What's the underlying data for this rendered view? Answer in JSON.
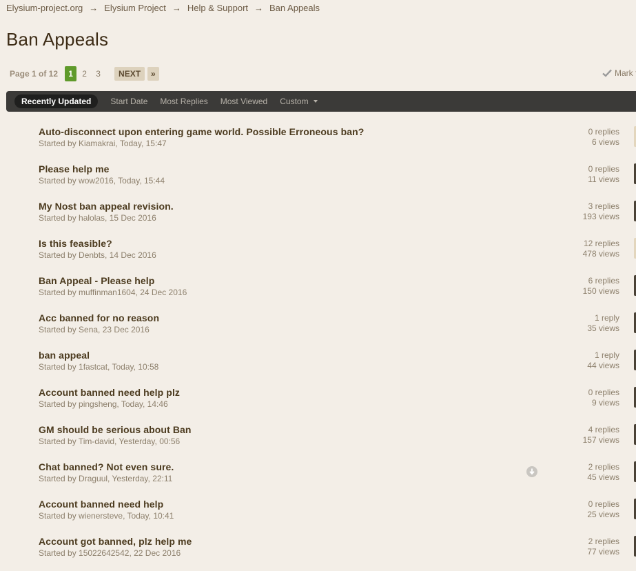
{
  "breadcrumb": {
    "items": [
      "Elysium-project.org",
      "Elysium Project",
      "Help & Support",
      "Ban Appeals"
    ],
    "separator": "→"
  },
  "page": {
    "title": "Ban Appeals"
  },
  "pagination": {
    "label": "Page 1 of 12",
    "pages": [
      "1",
      "2",
      "3"
    ],
    "current": "1",
    "next_label": "NEXT",
    "last_label": "»"
  },
  "mark_read": {
    "label": "Mark f"
  },
  "filters": {
    "recently_updated": "Recently Updated",
    "start_date": "Start Date",
    "most_replies": "Most Replies",
    "most_viewed": "Most Viewed",
    "custom": "Custom"
  },
  "topics": [
    {
      "title": "Auto-disconnect upon entering game world. Possible Erroneous ban?",
      "meta": "Started by Kiamakrai, Today, 15:47",
      "replies": "0 replies",
      "views": "6 views"
    },
    {
      "title": "Please help me",
      "meta": "Started by wow2016, Today, 15:44",
      "replies": "0 replies",
      "views": "11 views"
    },
    {
      "title": "My Nost ban appeal revision.",
      "meta": "Started by halolas, 15 Dec 2016",
      "replies": "3 replies",
      "views": "193 views"
    },
    {
      "title": "Is this feasible?",
      "meta": "Started by Denbts, 14 Dec 2016",
      "replies": "12 replies",
      "views": "478 views"
    },
    {
      "title": "Ban Appeal - Please help",
      "meta": "Started by muffinman1604, 24 Dec 2016",
      "replies": "6 replies",
      "views": "150 views"
    },
    {
      "title": "Acc banned for no reason",
      "meta": "Started by Sena, 23 Dec 2016",
      "replies": "1 reply",
      "views": "35 views"
    },
    {
      "title": "ban appeal",
      "meta": "Started by 1fastcat, Today, 10:58",
      "replies": "1 reply",
      "views": "44 views"
    },
    {
      "title": "Account banned need help plz",
      "meta": "Started by pingsheng, Today, 14:46",
      "replies": "0 replies",
      "views": "9 views"
    },
    {
      "title": "GM should be serious about Ban",
      "meta": "Started by Tim-david, Yesterday, 00:56",
      "replies": "4 replies",
      "views": "157 views"
    },
    {
      "title": "Chat banned? Not even sure.",
      "meta": "Started by Draguul, Yesterday, 22:11",
      "replies": "2 replies",
      "views": "45 views"
    },
    {
      "title": "Account banned need help",
      "meta": "Started by wienersteve, Today, 10:41",
      "replies": "0 replies",
      "views": "25 views"
    },
    {
      "title": "Account got banned, plz help me",
      "meta": "Started by 15022642542, 22 Dec 2016",
      "replies": "2 replies",
      "views": "77 views"
    }
  ],
  "colors": {
    "background": "#f3eee7",
    "active_page": "#5f9a2b",
    "filter_bar": "#3b3a38",
    "title_text": "#4b3a1e"
  },
  "icons": {
    "mark_read": "check-icon",
    "row_action": "arrow-down-circle-icon"
  }
}
